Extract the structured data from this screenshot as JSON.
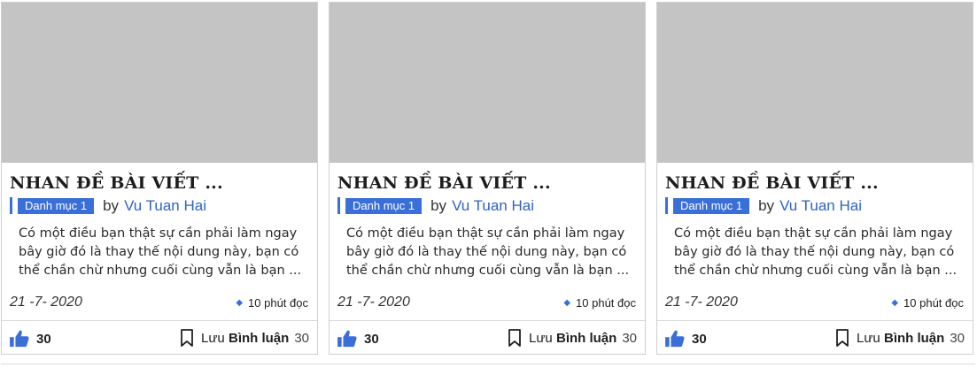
{
  "cards": [
    {
      "title": "NHAN ĐỀ BÀI VIẾT ...",
      "category": "Danh mục 1",
      "by": "by",
      "author": "Vu Tuan Hai",
      "excerpt": "Có một điều bạn thật sự cần phải làm ngay bây giờ đó là thay thế nội dung này, bạn có thể chần chừ nhưng cuối cùng vẫn là bạn ...",
      "date": "21 -7- 2020",
      "read_time": "10 phút đọc",
      "likes": "30",
      "save_label": "Lưu",
      "comment_label": "Bình luận",
      "comment_count": "30"
    },
    {
      "title": "NHAN ĐỀ BÀI VIẾT ...",
      "category": "Danh mục 1",
      "by": "by",
      "author": "Vu Tuan Hai",
      "excerpt": "Có một điều bạn thật sự cần phải làm ngay bây giờ đó là thay thế nội dung này, bạn có thể chần chừ nhưng cuối cùng vẫn là bạn ...",
      "date": "21 -7- 2020",
      "read_time": "10 phút đọc",
      "likes": "30",
      "save_label": "Lưu",
      "comment_label": "Bình luận",
      "comment_count": "30"
    },
    {
      "title": "NHAN ĐỀ BÀI VIẾT ...",
      "category": "Danh mục 1",
      "by": "by",
      "author": "Vu Tuan Hai",
      "excerpt": "Có một điều bạn thật sự cần phải làm ngay bây giờ đó là thay thế nội dung này, bạn có thể chần chừ nhưng cuối cùng vẫn là bạn ...",
      "date": "21 -7- 2020",
      "read_time": "10 phút đọc",
      "likes": "30",
      "save_label": "Lưu",
      "comment_label": "Bình luận",
      "comment_count": "30"
    }
  ],
  "icons": {
    "like": "thumbs-up-icon",
    "save": "bookmark-icon",
    "read": "diamond-dot-icon"
  },
  "colors": {
    "accent": "#3a6fd8",
    "author": "#2f62c8",
    "thumbnail": "#c4c4c4"
  }
}
